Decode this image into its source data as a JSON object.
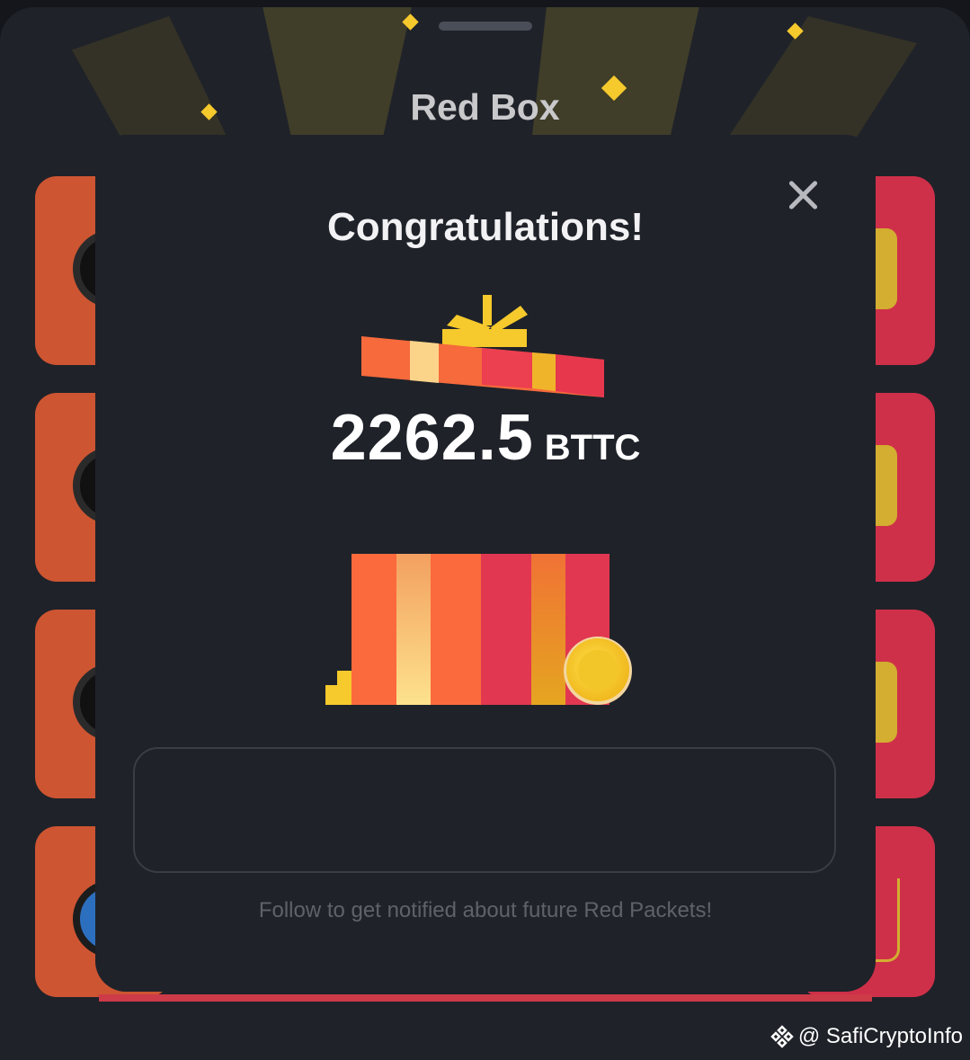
{
  "sheet": {
    "title": "Red Box"
  },
  "modal": {
    "title": "Congratulations!",
    "amount": "2262.5",
    "currency": "BTTC",
    "follow_note": "Follow to get notified about future Red Packets!"
  },
  "watermark": {
    "text": "@ SafiCryptoInfo"
  },
  "icons": [
    "close-icon",
    "gift-lid-icon",
    "gift-box-icon",
    "coin-icon",
    "binance-logo-icon"
  ],
  "colors": {
    "background": "#1f2229",
    "accent_orange": "#cd5532",
    "accent_red": "#cf3049",
    "gold": "#f6c92c"
  }
}
